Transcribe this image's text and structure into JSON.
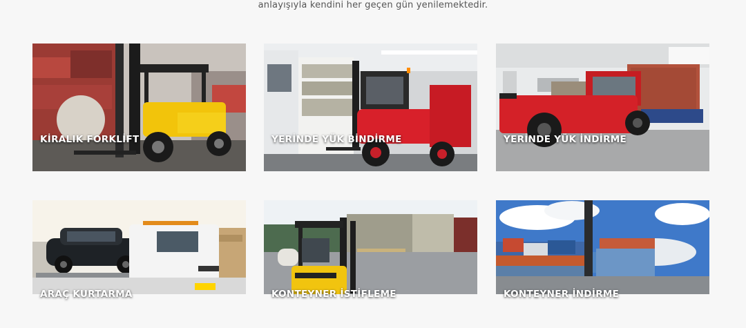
{
  "intro_text": "anlayışıyla kendini her geçen gün yenilemektedir.",
  "services": [
    {
      "label": "KİRALIK FORKLİFT"
    },
    {
      "label": "YERİNDE YÜK BİNDİRME"
    },
    {
      "label": "YERİNDE YÜK İNDİRME"
    },
    {
      "label": "ARAÇ KURTARMA"
    },
    {
      "label": "KONTEYNER İSTİFLEME"
    },
    {
      "label": "KONTEYNER İNDİRME"
    }
  ]
}
